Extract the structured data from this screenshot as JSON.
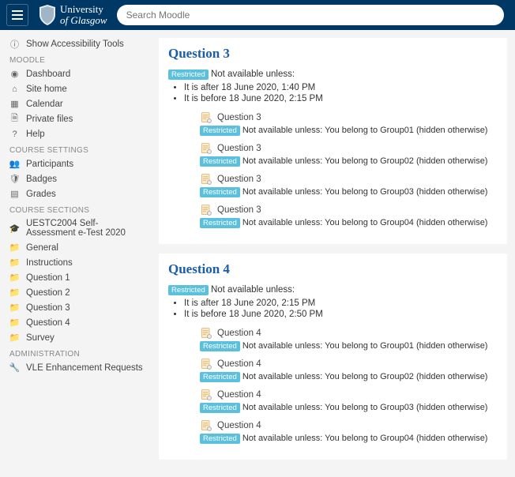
{
  "search": {
    "placeholder": "Search Moodle"
  },
  "logo": {
    "line1": "University",
    "line2": "of Glasgow"
  },
  "sidebar": {
    "access": "Show Accessibility Tools",
    "head_moodle": "MOODLE",
    "dashboard": "Dashboard",
    "sitehome": "Site home",
    "calendar": "Calendar",
    "private": "Private files",
    "help": "Help",
    "head_settings": "COURSE SETTINGS",
    "participants": "Participants",
    "badges": "Badges",
    "grades": "Grades",
    "head_sections": "COURSE SECTIONS",
    "course": "UESTC2004 Self-Assessment e-Test 2020",
    "general": "General",
    "instructions": "Instructions",
    "q1": "Question 1",
    "q2": "Question 2",
    "q3": "Question 3",
    "q4": "Question 4",
    "survey": "Survey",
    "head_admin": "ADMINISTRATION",
    "vle": "VLE Enhancement Requests"
  },
  "sections": [
    {
      "title": "Question 3",
      "restricted": "Restricted",
      "avail": "Not available unless:",
      "conds": [
        "It is after 18 June 2020, 1:40 PM",
        "It is before 18 June 2020, 2:15 PM"
      ],
      "acts": [
        {
          "name": "Question 3",
          "r": "Restricted",
          "msg": "Not available unless: You belong to Group01 (hidden otherwise)"
        },
        {
          "name": "Question 3",
          "r": "Restricted",
          "msg": "Not available unless: You belong to Group02 (hidden otherwise)"
        },
        {
          "name": "Question 3",
          "r": "Restricted",
          "msg": "Not available unless: You belong to Group03 (hidden otherwise)"
        },
        {
          "name": "Question 3",
          "r": "Restricted",
          "msg": "Not available unless: You belong to Group04 (hidden otherwise)"
        }
      ]
    },
    {
      "title": "Question 4",
      "restricted": "Restricted",
      "avail": "Not available unless:",
      "conds": [
        "It is after 18 June 2020, 2:15 PM",
        "It is before 18 June 2020, 2:50 PM"
      ],
      "acts": [
        {
          "name": "Question 4",
          "r": "Restricted",
          "msg": "Not available unless: You belong to Group01 (hidden otherwise)"
        },
        {
          "name": "Question 4",
          "r": "Restricted",
          "msg": "Not available unless: You belong to Group02 (hidden otherwise)"
        },
        {
          "name": "Question 4",
          "r": "Restricted",
          "msg": "Not available unless: You belong to Group03 (hidden otherwise)"
        },
        {
          "name": "Question 4",
          "r": "Restricted",
          "msg": "Not available unless: You belong to Group04 (hidden otherwise)"
        }
      ]
    }
  ]
}
